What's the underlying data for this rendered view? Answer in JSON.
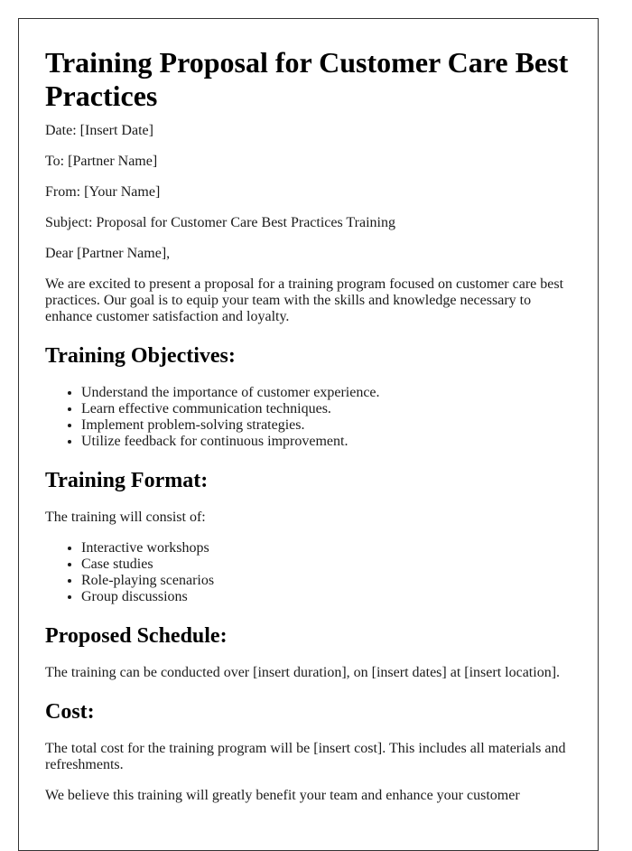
{
  "document": {
    "title": "Training Proposal for Customer Care Best Practices",
    "header_fields": [
      {
        "label": "Date:",
        "value": "[Insert Date]"
      },
      {
        "label": "To:",
        "value": "[Partner Name]"
      },
      {
        "label": "From:",
        "value": "[Your Name]"
      },
      {
        "label": "Subject:",
        "value": "Proposal for Customer Care Best Practices Training"
      }
    ],
    "salutation": "Dear [Partner Name],",
    "intro": "We are excited to present a proposal for a training program focused on customer care best practices. Our goal is to equip your team with the skills and knowledge necessary to enhance customer satisfaction and loyalty.",
    "sections": {
      "objectives": {
        "heading": "Training Objectives:",
        "items": [
          "Understand the importance of customer experience.",
          "Learn effective communication techniques.",
          "Implement problem-solving strategies.",
          "Utilize feedback for continuous improvement."
        ]
      },
      "format": {
        "heading": "Training Format:",
        "intro": "The training will consist of:",
        "items": [
          "Interactive workshops",
          "Case studies",
          "Role-playing scenarios",
          "Group discussions"
        ]
      },
      "schedule": {
        "heading": "Proposed Schedule:",
        "text": "The training can be conducted over [insert duration], on [insert dates] at [insert location]."
      },
      "cost": {
        "heading": "Cost:",
        "text": "The total cost for the training program will be [insert cost]. This includes all materials and refreshments."
      }
    },
    "closing": "We believe this training will greatly benefit your team and enhance your customer"
  }
}
